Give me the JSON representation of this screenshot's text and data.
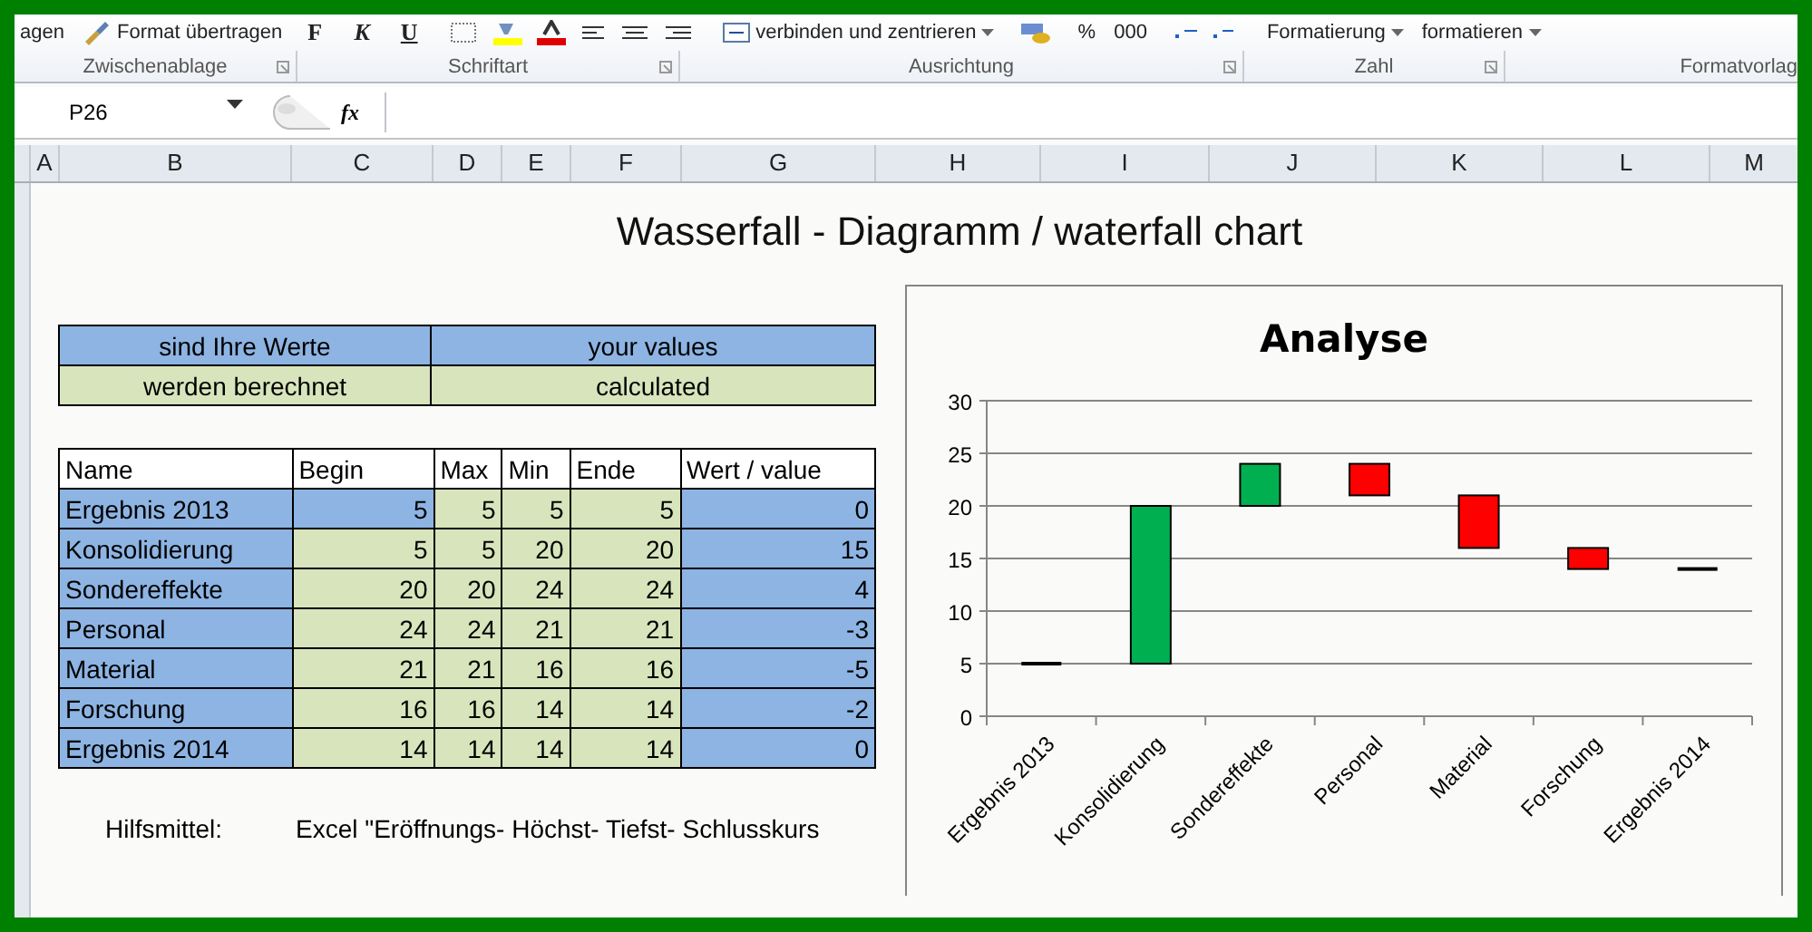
{
  "ribbon": {
    "top_items": [
      {
        "kind": "text",
        "label": "agen"
      },
      {
        "kind": "brush",
        "label": "Format übertragen"
      },
      {
        "kind": "bold",
        "label": "F"
      },
      {
        "kind": "italic",
        "label": "K"
      },
      {
        "kind": "underline",
        "label": "U"
      },
      {
        "kind": "merge",
        "label": "verbinden und zentrieren"
      },
      {
        "kind": "text",
        "label": "%"
      },
      {
        "kind": "text",
        "label": "000"
      },
      {
        "kind": "dropdown",
        "label": "Formatierung"
      },
      {
        "kind": "dropdown",
        "label": "formatieren"
      }
    ],
    "groups": [
      {
        "label": "Zwischenablage"
      },
      {
        "label": "Schriftart"
      },
      {
        "label": "Ausrichtung"
      },
      {
        "label": "Zahl"
      },
      {
        "label": "Formatvorlag"
      }
    ]
  },
  "formula_bar": {
    "name_box": "P26",
    "fx": "fx"
  },
  "columns": [
    {
      "label": "A"
    },
    {
      "label": "B"
    },
    {
      "label": "C"
    },
    {
      "label": "D"
    },
    {
      "label": "E"
    },
    {
      "label": "F"
    },
    {
      "label": "G"
    },
    {
      "label": "H"
    },
    {
      "label": "I"
    },
    {
      "label": "J"
    },
    {
      "label": "K"
    },
    {
      "label": "L"
    },
    {
      "label": "M"
    }
  ],
  "sheet": {
    "title": "Wasserfall - Diagramm / waterfall chart",
    "legend": [
      {
        "color": "#8db4e2",
        "de": "sind Ihre Werte",
        "en": "your values"
      },
      {
        "color": "#d8e4bc",
        "de": "werden berechnet",
        "en": "calculated"
      }
    ],
    "table": {
      "columns": [
        "Name",
        "Begin",
        "Max",
        "Min",
        "Ende",
        "Wert / value"
      ],
      "rows": [
        {
          "name": "Ergebnis 2013",
          "begin": {
            "text": "5",
            "color": "#8db4e2"
          },
          "max": "5",
          "min": "5",
          "ende": "5",
          "value": "0"
        },
        {
          "name": "Konsolidierung",
          "begin": {
            "text": "5",
            "color": "#d8e4bc"
          },
          "max": "5",
          "min": "20",
          "ende": "20",
          "value": "15"
        },
        {
          "name": "Sondereffekte",
          "begin": {
            "text": "20",
            "color": "#d8e4bc"
          },
          "max": "20",
          "min": "24",
          "ende": "24",
          "value": "4"
        },
        {
          "name": "Personal",
          "begin": {
            "text": "24",
            "color": "#d8e4bc"
          },
          "max": "24",
          "min": "21",
          "ende": "21",
          "value": "-3"
        },
        {
          "name": "Material",
          "begin": {
            "text": "21",
            "color": "#d8e4bc"
          },
          "max": "21",
          "min": "16",
          "ende": "16",
          "value": "-5"
        },
        {
          "name": "Forschung",
          "begin": {
            "text": "16",
            "color": "#d8e4bc"
          },
          "max": "16",
          "min": "14",
          "ende": "14",
          "value": "-2"
        },
        {
          "name": "Ergebnis 2014",
          "begin": {
            "text": "14",
            "color": "#d8e4bc"
          },
          "max": "14",
          "min": "14",
          "ende": "14",
          "value": "0"
        }
      ]
    },
    "note": {
      "label": "Hilfsmittel:",
      "text": "Excel \"Eröffnungs- Höchst- Tiefst- Schlusskurs"
    },
    "chart_data": {
      "type": "candlestick",
      "title": "Analyse",
      "categories": [
        "Ergebnis 2013",
        "Konsolidierung",
        "Sondereffekte",
        "Personal",
        "Material",
        "Forschung",
        "Ergebnis 2014"
      ],
      "ylim": [
        0,
        30
      ],
      "grid": true,
      "yticks": [
        0,
        5,
        10,
        15,
        20,
        25,
        30
      ],
      "ohlc": [
        [
          5,
          5,
          5,
          5
        ],
        [
          5,
          20,
          5,
          20
        ],
        [
          20,
          24,
          20,
          24
        ],
        [
          24,
          24,
          21,
          21
        ],
        [
          21,
          21,
          16,
          16
        ],
        [
          16,
          16,
          14,
          14
        ],
        [
          14,
          14,
          14,
          14
        ]
      ]
    }
  }
}
